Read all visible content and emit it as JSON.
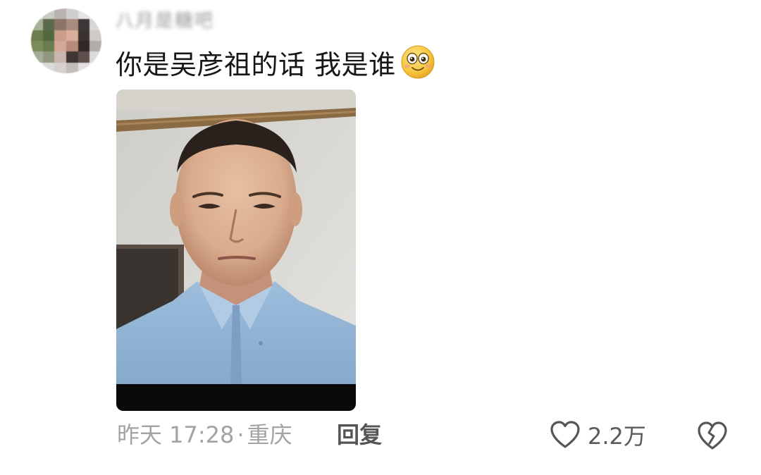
{
  "comment": {
    "username": "八月是糖吧",
    "text": "你是吴彦祖的话 我是谁",
    "emoji": "smile-emoji",
    "time": "昨天 17:28",
    "separator": "·",
    "location": "重庆",
    "reply_label": "回复",
    "like_count": "2.2万"
  },
  "colors": {
    "meta_text": "#a3a3a3",
    "reply_text": "#555555",
    "icon_stroke": "#555555",
    "shirt_blue": "#8fb2d4",
    "wall": "#d8d6d1"
  },
  "icons": {
    "like": "heart-icon",
    "dislike": "broken-heart-icon"
  }
}
